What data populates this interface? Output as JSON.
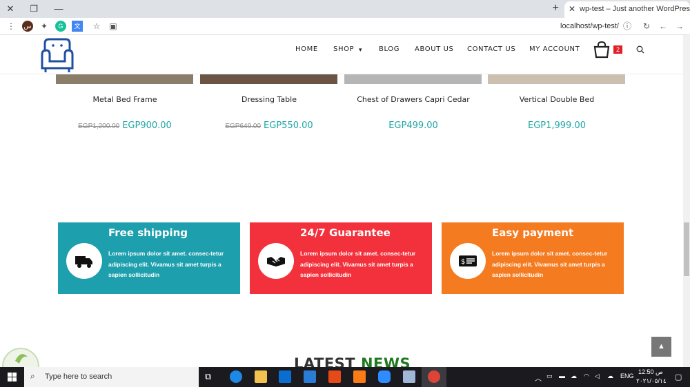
{
  "browser": {
    "tab_title": "wp-test – Just another WordPress",
    "url": "localhost/wp-test/",
    "profile_initial": "س"
  },
  "header": {
    "nav": [
      "HOME",
      "SHOP",
      "BLOG",
      "ABOUT US",
      "CONTACT US",
      "MY ACCOUNT"
    ],
    "cart_count": "2"
  },
  "products": [
    {
      "name": "Metal Bed Frame",
      "old_price": "EGP1,200.00",
      "price": "EGP900.00"
    },
    {
      "name": "Dressing Table",
      "old_price": "EGP649.00",
      "price": "EGP550.00"
    },
    {
      "name": "Chest of Drawers Capri Cedar",
      "old_price": "",
      "price": "EGP499.00"
    },
    {
      "name": "Vertical Double Bed",
      "old_price": "",
      "price": "EGP1,999.00"
    }
  ],
  "features": [
    {
      "title": "Free shipping",
      "text": "Lorem ipsum dolor sit amet. consec-tetur adipiscing elit. Vivamus sit amet turpis a sapien sollicitudin",
      "color": "#1e9fad",
      "icon": "truck-icon"
    },
    {
      "title": "24/7 Guarantee",
      "text": "Lorem ipsum dolor sit amet. consec-tetur adipiscing elit. Vivamus sit amet turpis a sapien sollicitudin",
      "color": "#f2313c",
      "icon": "handshake-icon"
    },
    {
      "title": "Easy payment",
      "text": "Lorem ipsum dolor sit amet. consec-tetur adipiscing elit. Vivamus sit amet turpis a sapien sollicitudin",
      "color": "#f47b20",
      "icon": "payment-icon"
    }
  ],
  "latest": {
    "word1": "LATEST",
    "word2": "NEWS"
  },
  "taskbar": {
    "search_placeholder": "Type here to search",
    "lang": "ENG",
    "time": "12:50 ص",
    "date": "٢٠٢١/٠٥/١٤"
  }
}
